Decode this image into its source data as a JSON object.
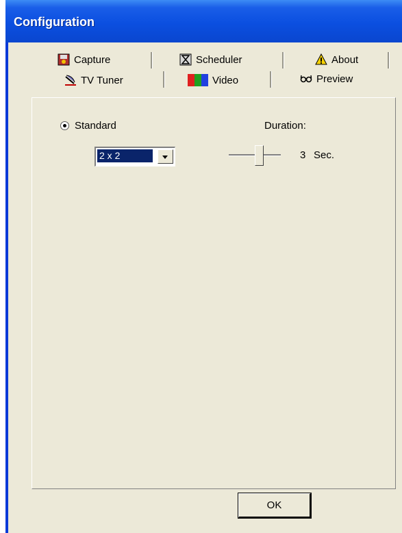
{
  "window": {
    "title": "Configuration"
  },
  "tabs": {
    "row_back": [
      {
        "label": "Capture",
        "icon": "capture-disk-icon"
      },
      {
        "label": "Scheduler",
        "icon": "hourglass-icon"
      },
      {
        "label": "About",
        "icon": "warning-icon"
      }
    ],
    "row_front": [
      {
        "label": "TV Tuner",
        "icon": "satellite-dish-icon"
      },
      {
        "label": "Video",
        "icon": "color-bars-icon"
      },
      {
        "label": "Preview",
        "icon": "glasses-icon",
        "active": true
      }
    ]
  },
  "preview": {
    "mode_label": "Standard",
    "mode_selected": true,
    "layout_value": "2 x 2",
    "duration_label": "Duration:",
    "duration_value": "3",
    "duration_unit": "Sec.",
    "duration_slider_fraction": 0.6
  },
  "buttons": {
    "ok_label": "OK"
  },
  "colors": {
    "titlebar": "#0b4fe0",
    "dialog": "#ece9d8",
    "selection": "#0a246a"
  }
}
